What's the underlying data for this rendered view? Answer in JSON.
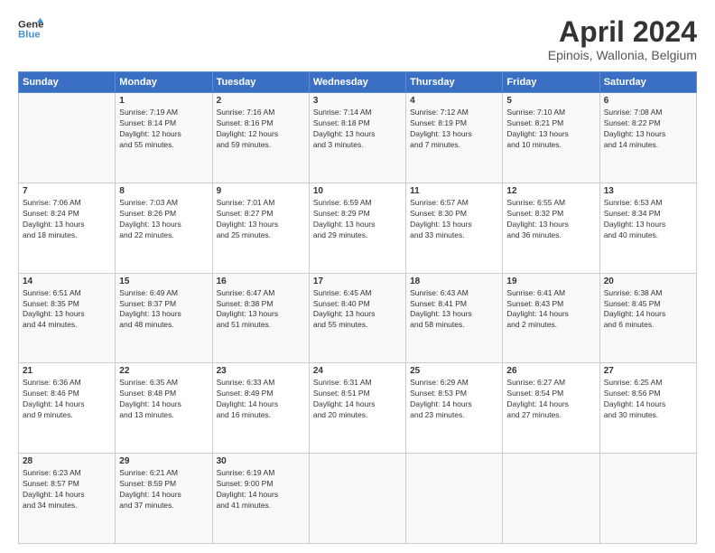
{
  "header": {
    "logo_line1": "General",
    "logo_line2": "Blue",
    "title": "April 2024",
    "subtitle": "Epinois, Wallonia, Belgium"
  },
  "columns": [
    "Sunday",
    "Monday",
    "Tuesday",
    "Wednesday",
    "Thursday",
    "Friday",
    "Saturday"
  ],
  "weeks": [
    [
      {
        "day": "",
        "info": ""
      },
      {
        "day": "1",
        "info": "Sunrise: 7:19 AM\nSunset: 8:14 PM\nDaylight: 12 hours\nand 55 minutes."
      },
      {
        "day": "2",
        "info": "Sunrise: 7:16 AM\nSunset: 8:16 PM\nDaylight: 12 hours\nand 59 minutes."
      },
      {
        "day": "3",
        "info": "Sunrise: 7:14 AM\nSunset: 8:18 PM\nDaylight: 13 hours\nand 3 minutes."
      },
      {
        "day": "4",
        "info": "Sunrise: 7:12 AM\nSunset: 8:19 PM\nDaylight: 13 hours\nand 7 minutes."
      },
      {
        "day": "5",
        "info": "Sunrise: 7:10 AM\nSunset: 8:21 PM\nDaylight: 13 hours\nand 10 minutes."
      },
      {
        "day": "6",
        "info": "Sunrise: 7:08 AM\nSunset: 8:22 PM\nDaylight: 13 hours\nand 14 minutes."
      }
    ],
    [
      {
        "day": "7",
        "info": "Sunrise: 7:06 AM\nSunset: 8:24 PM\nDaylight: 13 hours\nand 18 minutes."
      },
      {
        "day": "8",
        "info": "Sunrise: 7:03 AM\nSunset: 8:26 PM\nDaylight: 13 hours\nand 22 minutes."
      },
      {
        "day": "9",
        "info": "Sunrise: 7:01 AM\nSunset: 8:27 PM\nDaylight: 13 hours\nand 25 minutes."
      },
      {
        "day": "10",
        "info": "Sunrise: 6:59 AM\nSunset: 8:29 PM\nDaylight: 13 hours\nand 29 minutes."
      },
      {
        "day": "11",
        "info": "Sunrise: 6:57 AM\nSunset: 8:30 PM\nDaylight: 13 hours\nand 33 minutes."
      },
      {
        "day": "12",
        "info": "Sunrise: 6:55 AM\nSunset: 8:32 PM\nDaylight: 13 hours\nand 36 minutes."
      },
      {
        "day": "13",
        "info": "Sunrise: 6:53 AM\nSunset: 8:34 PM\nDaylight: 13 hours\nand 40 minutes."
      }
    ],
    [
      {
        "day": "14",
        "info": "Sunrise: 6:51 AM\nSunset: 8:35 PM\nDaylight: 13 hours\nand 44 minutes."
      },
      {
        "day": "15",
        "info": "Sunrise: 6:49 AM\nSunset: 8:37 PM\nDaylight: 13 hours\nand 48 minutes."
      },
      {
        "day": "16",
        "info": "Sunrise: 6:47 AM\nSunset: 8:38 PM\nDaylight: 13 hours\nand 51 minutes."
      },
      {
        "day": "17",
        "info": "Sunrise: 6:45 AM\nSunset: 8:40 PM\nDaylight: 13 hours\nand 55 minutes."
      },
      {
        "day": "18",
        "info": "Sunrise: 6:43 AM\nSunset: 8:41 PM\nDaylight: 13 hours\nand 58 minutes."
      },
      {
        "day": "19",
        "info": "Sunrise: 6:41 AM\nSunset: 8:43 PM\nDaylight: 14 hours\nand 2 minutes."
      },
      {
        "day": "20",
        "info": "Sunrise: 6:38 AM\nSunset: 8:45 PM\nDaylight: 14 hours\nand 6 minutes."
      }
    ],
    [
      {
        "day": "21",
        "info": "Sunrise: 6:36 AM\nSunset: 8:46 PM\nDaylight: 14 hours\nand 9 minutes."
      },
      {
        "day": "22",
        "info": "Sunrise: 6:35 AM\nSunset: 8:48 PM\nDaylight: 14 hours\nand 13 minutes."
      },
      {
        "day": "23",
        "info": "Sunrise: 6:33 AM\nSunset: 8:49 PM\nDaylight: 14 hours\nand 16 minutes."
      },
      {
        "day": "24",
        "info": "Sunrise: 6:31 AM\nSunset: 8:51 PM\nDaylight: 14 hours\nand 20 minutes."
      },
      {
        "day": "25",
        "info": "Sunrise: 6:29 AM\nSunset: 8:53 PM\nDaylight: 14 hours\nand 23 minutes."
      },
      {
        "day": "26",
        "info": "Sunrise: 6:27 AM\nSunset: 8:54 PM\nDaylight: 14 hours\nand 27 minutes."
      },
      {
        "day": "27",
        "info": "Sunrise: 6:25 AM\nSunset: 8:56 PM\nDaylight: 14 hours\nand 30 minutes."
      }
    ],
    [
      {
        "day": "28",
        "info": "Sunrise: 6:23 AM\nSunset: 8:57 PM\nDaylight: 14 hours\nand 34 minutes."
      },
      {
        "day": "29",
        "info": "Sunrise: 6:21 AM\nSunset: 8:59 PM\nDaylight: 14 hours\nand 37 minutes."
      },
      {
        "day": "30",
        "info": "Sunrise: 6:19 AM\nSunset: 9:00 PM\nDaylight: 14 hours\nand 41 minutes."
      },
      {
        "day": "",
        "info": ""
      },
      {
        "day": "",
        "info": ""
      },
      {
        "day": "",
        "info": ""
      },
      {
        "day": "",
        "info": ""
      }
    ]
  ]
}
